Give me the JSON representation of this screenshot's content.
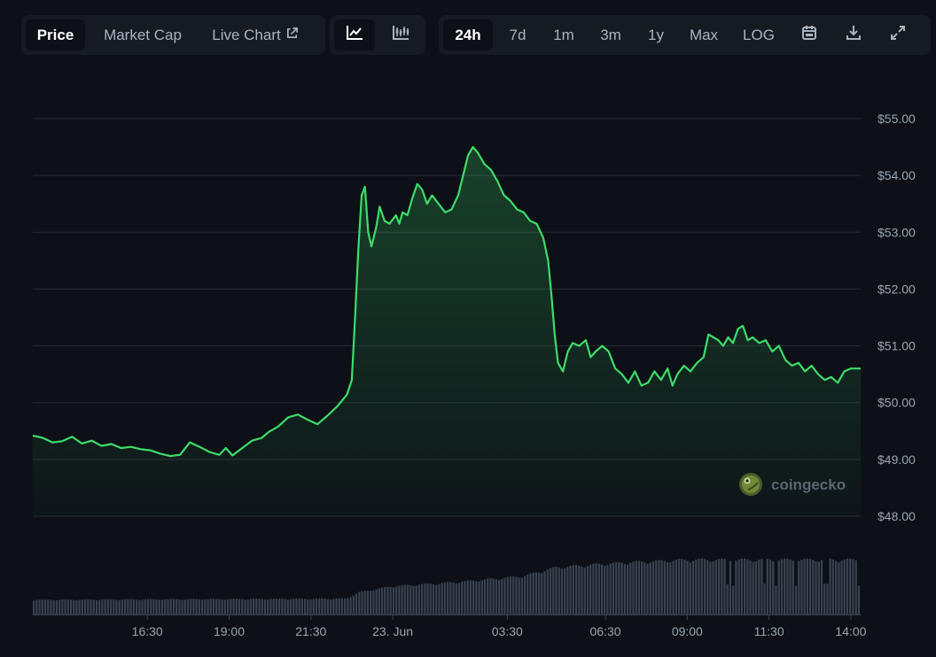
{
  "toolbar": {
    "type_tabs": [
      {
        "label": "Price",
        "active": true
      },
      {
        "label": "Market Cap",
        "active": false
      },
      {
        "label": "Live Chart",
        "active": false
      }
    ],
    "style_icons": [
      {
        "icon": "line-chart-icon",
        "active": true
      },
      {
        "icon": "candlestick-chart-icon",
        "active": false
      }
    ],
    "range_tabs": [
      {
        "label": "24h",
        "active": true
      },
      {
        "label": "7d",
        "active": false
      },
      {
        "label": "1m",
        "active": false
      },
      {
        "label": "3m",
        "active": false
      },
      {
        "label": "1y",
        "active": false
      },
      {
        "label": "Max",
        "active": false
      },
      {
        "label": "LOG",
        "active": false
      }
    ],
    "action_icons": [
      "calendar-icon",
      "download-icon",
      "expand-icon"
    ]
  },
  "watermark": {
    "text": "coingecko",
    "icon": "coingecko-logo-icon"
  },
  "colors": {
    "background": "#0d1117",
    "line": "#3ddc6a",
    "grid": "#262c36",
    "volume": "#3a4250"
  },
  "chart_data": {
    "type": "area",
    "y_axis": {
      "ticks": [
        55,
        54,
        53,
        52,
        51,
        50,
        49,
        48
      ],
      "tick_labels": [
        "$55.00",
        "$54.00",
        "$53.00",
        "$52.00",
        "$51.00",
        "$50.00",
        "$49.00",
        "$48.00"
      ],
      "ylim": [
        48,
        55
      ],
      "position": "right",
      "grid": true
    },
    "x_axis": {
      "tick_labels": [
        "16:30",
        "19:00",
        "21:30",
        "23. Jun",
        "03:30",
        "06:30",
        "09:00",
        "11:30",
        "14:00"
      ],
      "tick_hours": [
        2.5,
        5.0,
        7.5,
        10.0,
        13.5,
        16.5,
        19.0,
        21.5,
        24.0
      ],
      "range_hours": [
        -1.0,
        24.3
      ]
    },
    "series": [
      {
        "points": [
          [
            -1.0,
            49.42
          ],
          [
            -0.7,
            49.38
          ],
          [
            -0.4,
            49.3
          ],
          [
            -0.1,
            49.32
          ],
          [
            0.2,
            49.4
          ],
          [
            0.5,
            49.28
          ],
          [
            0.8,
            49.33
          ],
          [
            1.1,
            49.24
          ],
          [
            1.4,
            49.27
          ],
          [
            1.7,
            49.2
          ],
          [
            2.0,
            49.22
          ],
          [
            2.3,
            49.18
          ],
          [
            2.6,
            49.16
          ],
          [
            2.9,
            49.1
          ],
          [
            3.2,
            49.06
          ],
          [
            3.5,
            49.08
          ],
          [
            3.8,
            49.3
          ],
          [
            4.1,
            49.22
          ],
          [
            4.4,
            49.13
          ],
          [
            4.7,
            49.08
          ],
          [
            4.9,
            49.2
          ],
          [
            5.1,
            49.07
          ],
          [
            5.4,
            49.2
          ],
          [
            5.7,
            49.33
          ],
          [
            6.0,
            49.38
          ],
          [
            6.2,
            49.48
          ],
          [
            6.5,
            49.58
          ],
          [
            6.8,
            49.74
          ],
          [
            7.1,
            49.79
          ],
          [
            7.4,
            49.7
          ],
          [
            7.7,
            49.62
          ],
          [
            8.0,
            49.77
          ],
          [
            8.3,
            49.93
          ],
          [
            8.6,
            50.14
          ],
          [
            8.75,
            50.4
          ],
          [
            8.85,
            51.5
          ],
          [
            8.95,
            52.7
          ],
          [
            9.05,
            53.65
          ],
          [
            9.15,
            53.8
          ],
          [
            9.25,
            53.0
          ],
          [
            9.35,
            52.75
          ],
          [
            9.5,
            53.1
          ],
          [
            9.6,
            53.45
          ],
          [
            9.75,
            53.2
          ],
          [
            9.9,
            53.15
          ],
          [
            10.1,
            53.3
          ],
          [
            10.2,
            53.15
          ],
          [
            10.3,
            53.35
          ],
          [
            10.45,
            53.3
          ],
          [
            10.6,
            53.6
          ],
          [
            10.75,
            53.85
          ],
          [
            10.9,
            53.75
          ],
          [
            11.05,
            53.5
          ],
          [
            11.2,
            53.65
          ],
          [
            11.4,
            53.5
          ],
          [
            11.6,
            53.35
          ],
          [
            11.8,
            53.4
          ],
          [
            12.0,
            53.65
          ],
          [
            12.15,
            54.0
          ],
          [
            12.3,
            54.35
          ],
          [
            12.45,
            54.5
          ],
          [
            12.6,
            54.4
          ],
          [
            12.8,
            54.2
          ],
          [
            13.0,
            54.1
          ],
          [
            13.2,
            53.9
          ],
          [
            13.4,
            53.65
          ],
          [
            13.6,
            53.55
          ],
          [
            13.8,
            53.4
          ],
          [
            14.0,
            53.35
          ],
          [
            14.2,
            53.2
          ],
          [
            14.4,
            53.15
          ],
          [
            14.6,
            52.9
          ],
          [
            14.75,
            52.5
          ],
          [
            14.85,
            51.9
          ],
          [
            14.95,
            51.2
          ],
          [
            15.05,
            50.7
          ],
          [
            15.2,
            50.55
          ],
          [
            15.35,
            50.9
          ],
          [
            15.5,
            51.05
          ],
          [
            15.7,
            51.0
          ],
          [
            15.9,
            51.1
          ],
          [
            16.05,
            50.8
          ],
          [
            16.2,
            50.9
          ],
          [
            16.4,
            51.0
          ],
          [
            16.6,
            50.9
          ],
          [
            16.8,
            50.6
          ],
          [
            17.0,
            50.5
          ],
          [
            17.2,
            50.35
          ],
          [
            17.4,
            50.55
          ],
          [
            17.6,
            50.3
          ],
          [
            17.8,
            50.35
          ],
          [
            18.0,
            50.55
          ],
          [
            18.2,
            50.4
          ],
          [
            18.4,
            50.6
          ],
          [
            18.55,
            50.3
          ],
          [
            18.7,
            50.5
          ],
          [
            18.9,
            50.65
          ],
          [
            19.1,
            50.55
          ],
          [
            19.3,
            50.7
          ],
          [
            19.5,
            50.8
          ],
          [
            19.65,
            51.2
          ],
          [
            19.8,
            51.15
          ],
          [
            19.95,
            51.1
          ],
          [
            20.1,
            51.0
          ],
          [
            20.25,
            51.15
          ],
          [
            20.4,
            51.05
          ],
          [
            20.55,
            51.3
          ],
          [
            20.7,
            51.35
          ],
          [
            20.85,
            51.1
          ],
          [
            21.0,
            51.15
          ],
          [
            21.2,
            51.05
          ],
          [
            21.4,
            51.1
          ],
          [
            21.6,
            50.9
          ],
          [
            21.8,
            51.0
          ],
          [
            22.0,
            50.75
          ],
          [
            22.2,
            50.65
          ],
          [
            22.4,
            50.7
          ],
          [
            22.6,
            50.55
          ],
          [
            22.8,
            50.65
          ],
          [
            23.0,
            50.5
          ],
          [
            23.2,
            50.4
          ],
          [
            23.4,
            50.45
          ],
          [
            23.6,
            50.35
          ],
          [
            23.8,
            50.55
          ],
          [
            24.0,
            50.6
          ],
          [
            24.3,
            50.6
          ]
        ]
      }
    ],
    "volume": {
      "relative_levels": [
        [
          -1.0,
          0.25
        ],
        [
          8.6,
          0.27
        ],
        [
          9.0,
          0.38
        ],
        [
          9.4,
          0.42
        ],
        [
          10.0,
          0.48
        ],
        [
          12.0,
          0.55
        ],
        [
          14.0,
          0.65
        ],
        [
          15.0,
          0.8
        ],
        [
          17.0,
          0.88
        ],
        [
          19.0,
          0.93
        ],
        [
          24.3,
          0.93
        ]
      ]
    }
  }
}
